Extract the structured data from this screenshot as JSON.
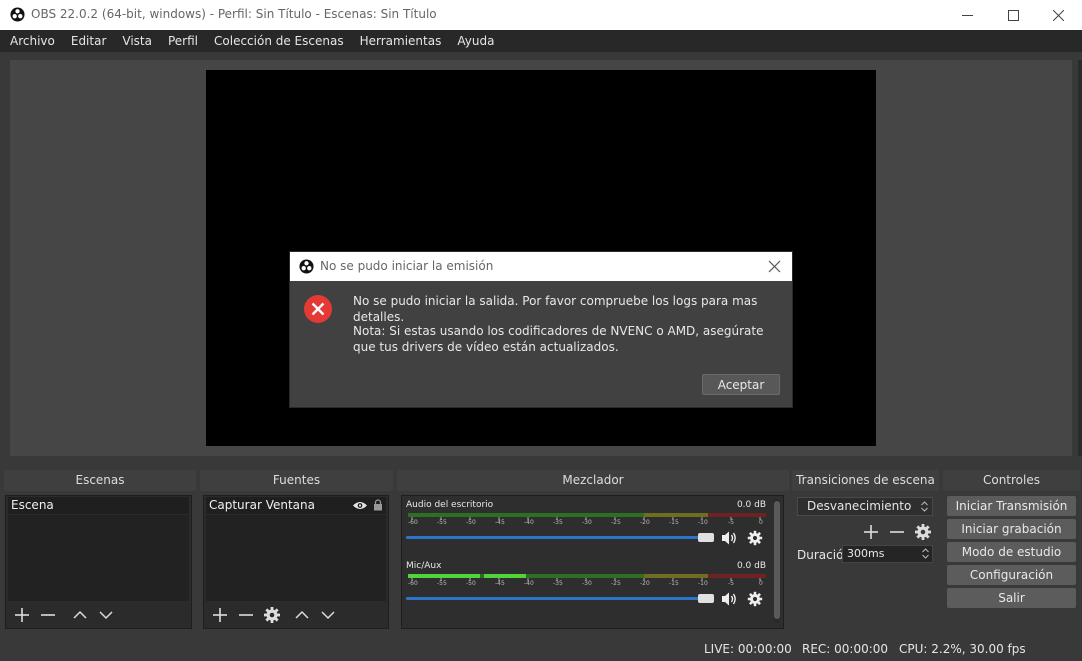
{
  "window": {
    "title": "OBS 22.0.2 (64-bit, windows) - Perfil: Sin Título - Escenas: Sin Título",
    "minimize_icon": "minimize-icon",
    "maximize_icon": "maximize-icon",
    "close_icon": "close-icon"
  },
  "menu": {
    "items": [
      "Archivo",
      "Editar",
      "Vista",
      "Perfil",
      "Colección de Escenas",
      "Herramientas",
      "Ayuda"
    ]
  },
  "dialog": {
    "title": "No se pudo iniciar la emisión",
    "message": "No se pudo iniciar la salida. Por favor compruebe los logs para mas detalles.",
    "note": "Nota: Si estas usando los codificadores de NVENC o AMD, asegúrate que tus drivers de vídeo están actualizados.",
    "ok_label": "Aceptar",
    "icon": "error-icon"
  },
  "docks": {
    "scenes": {
      "title": "Escenas",
      "items": [
        "Escena"
      ]
    },
    "sources": {
      "title": "Fuentes",
      "items": [
        "Capturar Ventana"
      ]
    },
    "mixer": {
      "title": "Mezclador",
      "tracks": [
        {
          "name": "Audio del escritorio",
          "db": "0.0 dB",
          "volume": 1.0
        },
        {
          "name": "Mic/Aux",
          "db": "0.0 dB",
          "volume": 1.0
        }
      ],
      "ticks": [
        "-60",
        "-55",
        "-50",
        "-45",
        "-40",
        "-35",
        "-30",
        "-25",
        "-20",
        "-15",
        "-10",
        "-5",
        "0"
      ]
    },
    "transitions": {
      "title": "Transiciones de escena",
      "selected": "Desvanecimiento",
      "duration_label": "Duración",
      "duration_value": "300ms"
    },
    "controls": {
      "title": "Controles",
      "buttons": [
        "Iniciar Transmisión",
        "Iniciar grabación",
        "Modo de estudio",
        "Configuración",
        "Salir"
      ]
    }
  },
  "status": {
    "live": "LIVE: 00:00:00",
    "rec": "REC: 00:00:00",
    "cpu": "CPU: 2.2%, 30.00 fps"
  },
  "colors": {
    "accent": "#2c74c8",
    "error": "#e53935",
    "meter_green": "#3c8a2e",
    "meter_yellow": "#8a8a2a",
    "meter_red": "#8a2a2a"
  }
}
